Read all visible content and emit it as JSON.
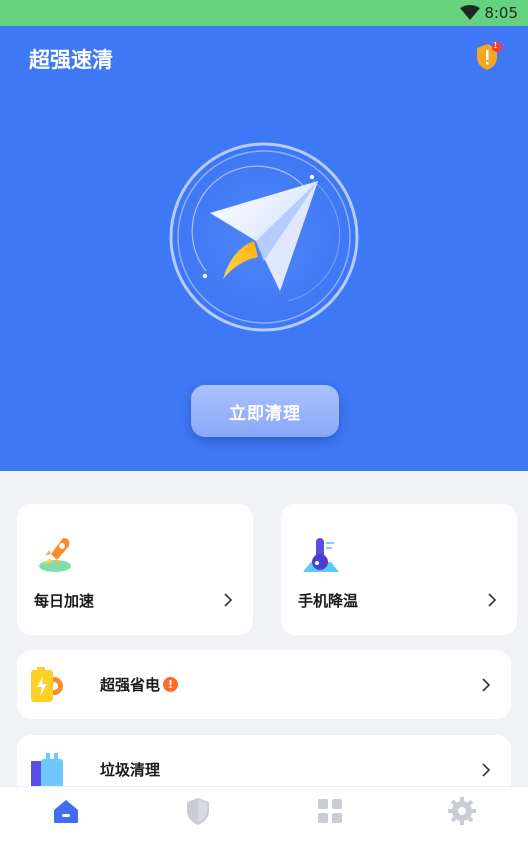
{
  "status_bar": {
    "time": "8:05",
    "wifi_icon": "wifi-icon"
  },
  "header": {
    "title": "超强速清",
    "notification_count": "1"
  },
  "hero": {
    "clean_button_label": "立即清理",
    "center_icon": "paper-plane-rocket-icon"
  },
  "feature_cards": [
    {
      "label": "每日加速",
      "icon": "rocket-icon"
    },
    {
      "label": "手机降温",
      "icon": "thermometer-icon"
    }
  ],
  "list_items": [
    {
      "label": "超强省电",
      "icon": "battery-icon",
      "badge": "!"
    },
    {
      "label": "垃圾清理",
      "icon": "trash-bin-icon"
    }
  ],
  "bottom_nav": [
    {
      "icon": "home-icon",
      "active": true
    },
    {
      "icon": "shield-icon",
      "active": false
    },
    {
      "icon": "apps-grid-icon",
      "active": false
    },
    {
      "icon": "gear-icon",
      "active": false
    }
  ],
  "colors": {
    "hero_blue": "#3f78f5",
    "status_green": "#66d17f",
    "active_nav": "#3f6ef0",
    "inactive_nav": "#c9ccd3"
  }
}
